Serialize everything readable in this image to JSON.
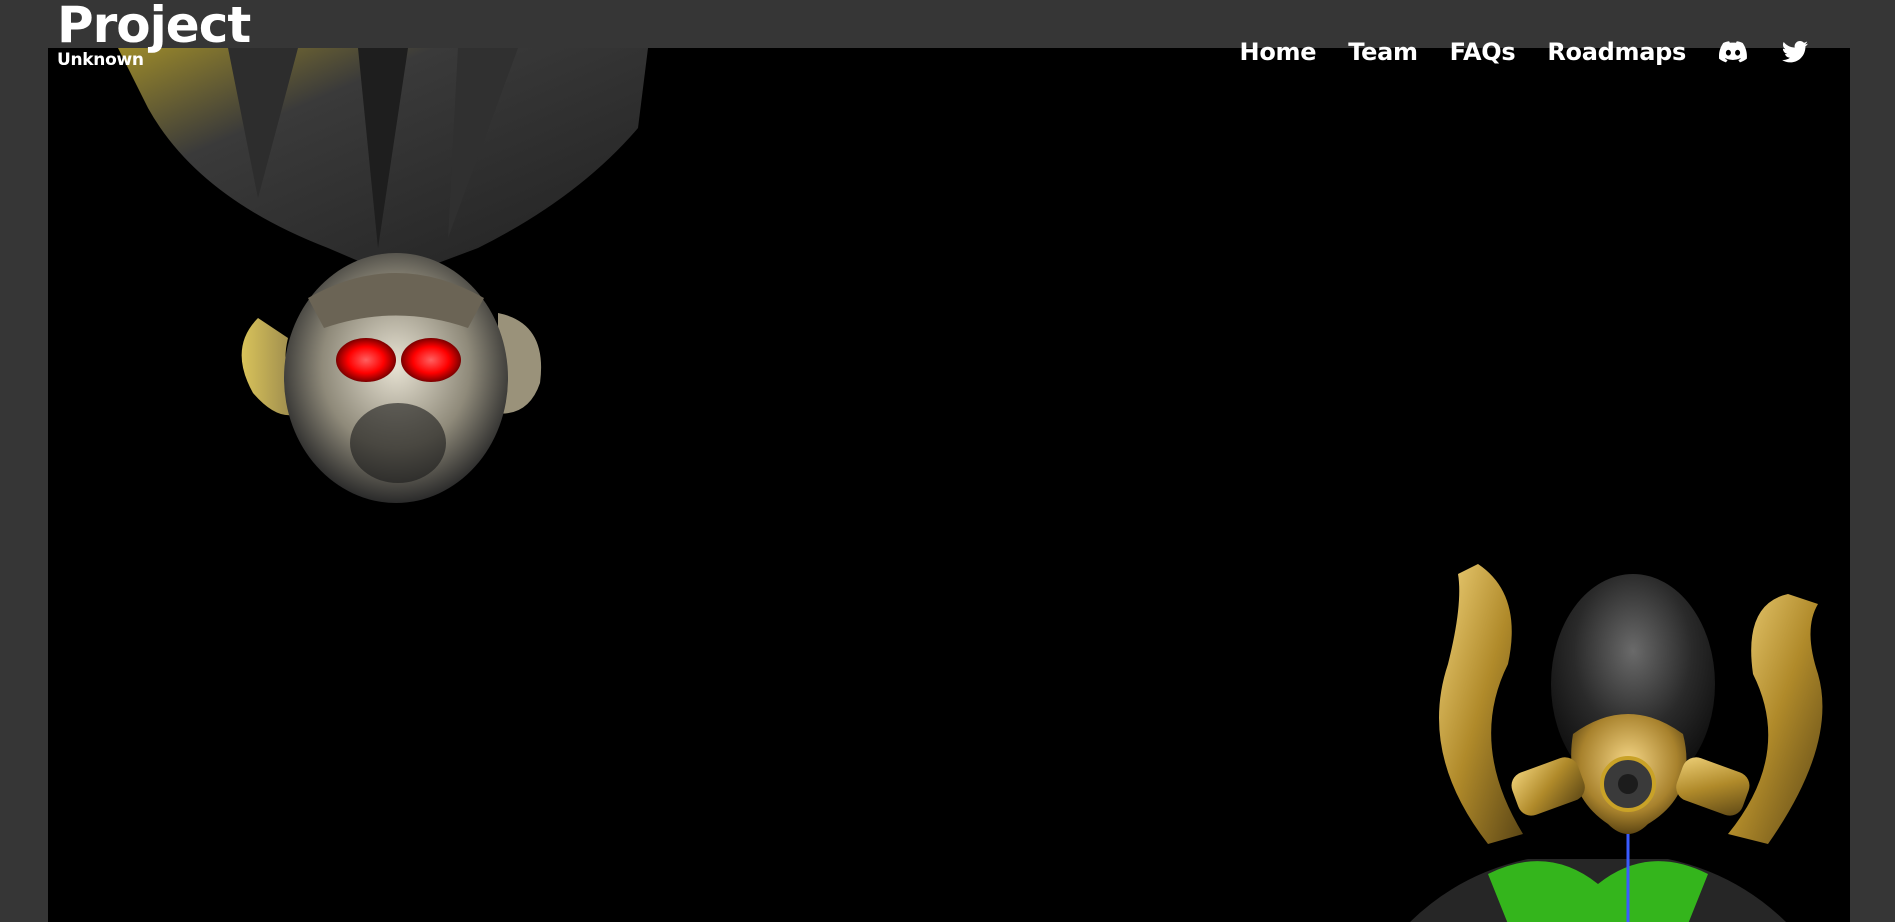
{
  "brand": {
    "title": "Project",
    "subtitle": "Unknown"
  },
  "nav": {
    "items": [
      {
        "label": "Home"
      },
      {
        "label": "Team"
      },
      {
        "label": "FAQs"
      },
      {
        "label": "Roadmaps"
      }
    ],
    "social": [
      {
        "icon": "discord-icon"
      },
      {
        "icon": "twitter-icon"
      }
    ]
  },
  "colors": {
    "page_background": "#363636",
    "hero_background": "#000000",
    "text": "#ffffff",
    "accent_gold": "#c9a227",
    "accent_red": "#ff1a1a",
    "accent_green": "#39e61a"
  }
}
